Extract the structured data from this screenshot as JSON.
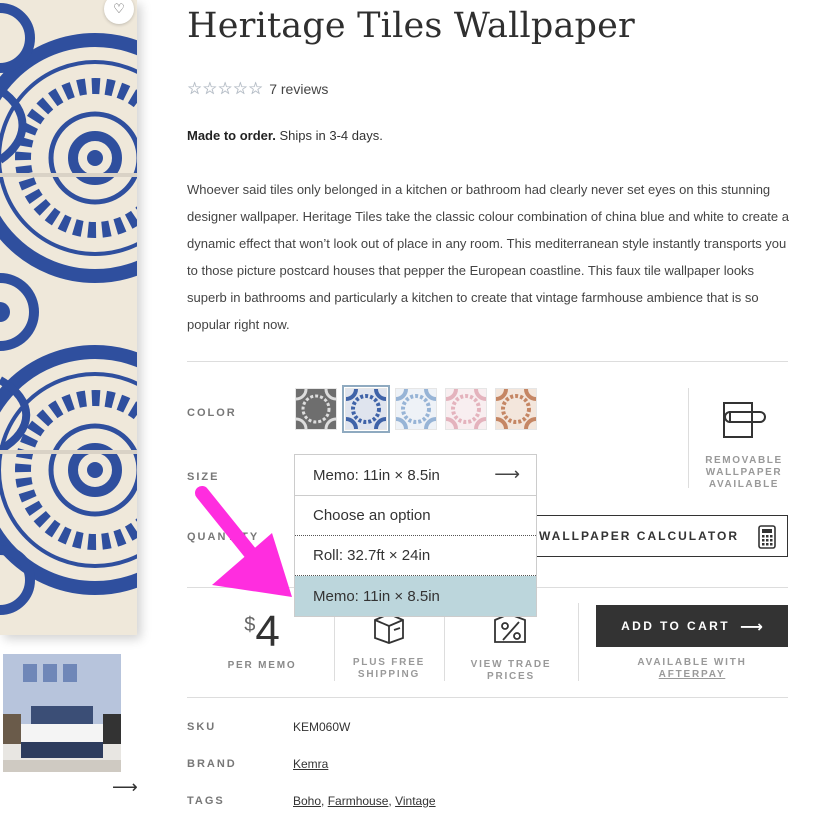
{
  "product": {
    "title": "Heritage Tiles Wallpaper",
    "rating_stars": 5,
    "reviews": "7 reviews",
    "made_to_order": "Made to order.",
    "ships": "Ships in 3-4 days.",
    "description": "Whoever said tiles only belonged in a kitchen or bathroom had clearly never set eyes on this stunning designer wallpaper. Heritage Tiles take the classic colour combination of china blue and white to create a dynamic effect that won’t look out of place in any room. This mediterranean style instantly transports you to those picture postcard houses that pepper the European coastline. This faux tile wallpaper looks superb in bathrooms and particularly a kitchen to create that vintage farmhouse ambience that is so popular right now."
  },
  "color": {
    "label": "COLOR",
    "swatches": [
      {
        "name": "charcoal",
        "color": "#6e6e6e"
      },
      {
        "name": "blue",
        "color": "#3f63a8"
      },
      {
        "name": "light-blue",
        "color": "#97b4d6"
      },
      {
        "name": "pink",
        "color": "#e4b3bd"
      },
      {
        "name": "terracotta",
        "color": "#c58664"
      }
    ],
    "selected_index": 1
  },
  "removable": {
    "text": "REMOVABLE WALLPAPER AVAILABLE"
  },
  "size": {
    "label": "SIZE",
    "selected": "Memo: 11in × 8.5in",
    "options": [
      "Choose an option",
      "Roll: 32.7ft × 24in",
      "Memo: 11in × 8.5in"
    ],
    "highlighted_index": 2
  },
  "quantity": {
    "label": "QUANTITY"
  },
  "calculator": {
    "label": "WALLPAPER CALCULATOR"
  },
  "price": {
    "currency": "$",
    "amount": "4",
    "unit": "PER MEMO"
  },
  "features": {
    "shipping": "PLUS FREE SHIPPING",
    "trade": "VIEW TRADE PRICES"
  },
  "cart": {
    "label": "ADD TO CART",
    "afterpay_prefix": "AVAILABLE WITH",
    "afterpay_link": "AFTERPAY"
  },
  "specs": {
    "sku_label": "SKU",
    "sku": "KEM060W",
    "brand_label": "BRAND",
    "brand": "Kemra",
    "tags_label": "TAGS",
    "tags": [
      "Boho",
      "Farmhouse",
      "Vintage"
    ]
  },
  "colors": {
    "accent": "#ff2ddf",
    "highlight": "#bcd6dc",
    "tile_blue": "#2f4f9e",
    "tile_bg": "#efe8da"
  }
}
